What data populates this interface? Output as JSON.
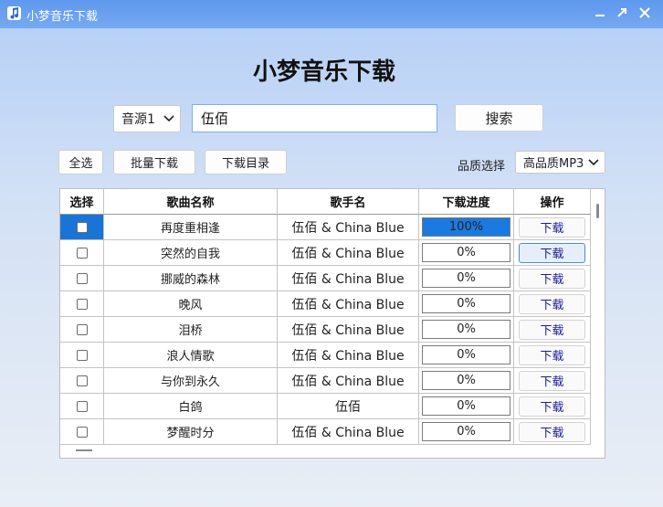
{
  "window": {
    "title": "小梦音乐下载",
    "icon": "music-note-icon"
  },
  "heading": "小梦音乐下载",
  "search": {
    "source_selected": "音源1",
    "query": "伍佰",
    "search_label": "搜索"
  },
  "toolbar": {
    "select_all": "全选",
    "batch_download": "批量下载",
    "download_dir": "下载目录",
    "quality_label": "品质选择",
    "quality_selected": "高品质MP3"
  },
  "table": {
    "headers": [
      "选择",
      "歌曲名称",
      "歌手名",
      "下载进度",
      "操作"
    ],
    "rows": [
      {
        "name": "再度重相逢",
        "artist": "伍佰 & China Blue",
        "progress": "100%",
        "action": "下载"
      },
      {
        "name": "突然的自我",
        "artist": "伍佰 & China Blue",
        "progress": "0%",
        "action": "下载"
      },
      {
        "name": "挪威的森林",
        "artist": "伍佰 & China Blue",
        "progress": "0%",
        "action": "下载"
      },
      {
        "name": "晚风",
        "artist": "伍佰 & China Blue",
        "progress": "0%",
        "action": "下载"
      },
      {
        "name": "泪桥",
        "artist": "伍佰 & China Blue",
        "progress": "0%",
        "action": "下载"
      },
      {
        "name": "浪人情歌",
        "artist": "伍佰 & China Blue",
        "progress": "0%",
        "action": "下载"
      },
      {
        "name": "与你到永久",
        "artist": "伍佰 & China Blue",
        "progress": "0%",
        "action": "下载"
      },
      {
        "name": "白鸽",
        "artist": "伍佰",
        "progress": "0%",
        "action": "下载"
      },
      {
        "name": "梦醒时分",
        "artist": "伍佰 & China Blue",
        "progress": "0%",
        "action": "下载"
      }
    ],
    "progress_values": [
      1,
      0,
      0,
      0,
      0,
      0,
      0,
      0,
      0
    ]
  },
  "colors": {
    "titlebar": "#5e98ee",
    "accent": "#1a74d6",
    "link": "#1a1a9a"
  }
}
